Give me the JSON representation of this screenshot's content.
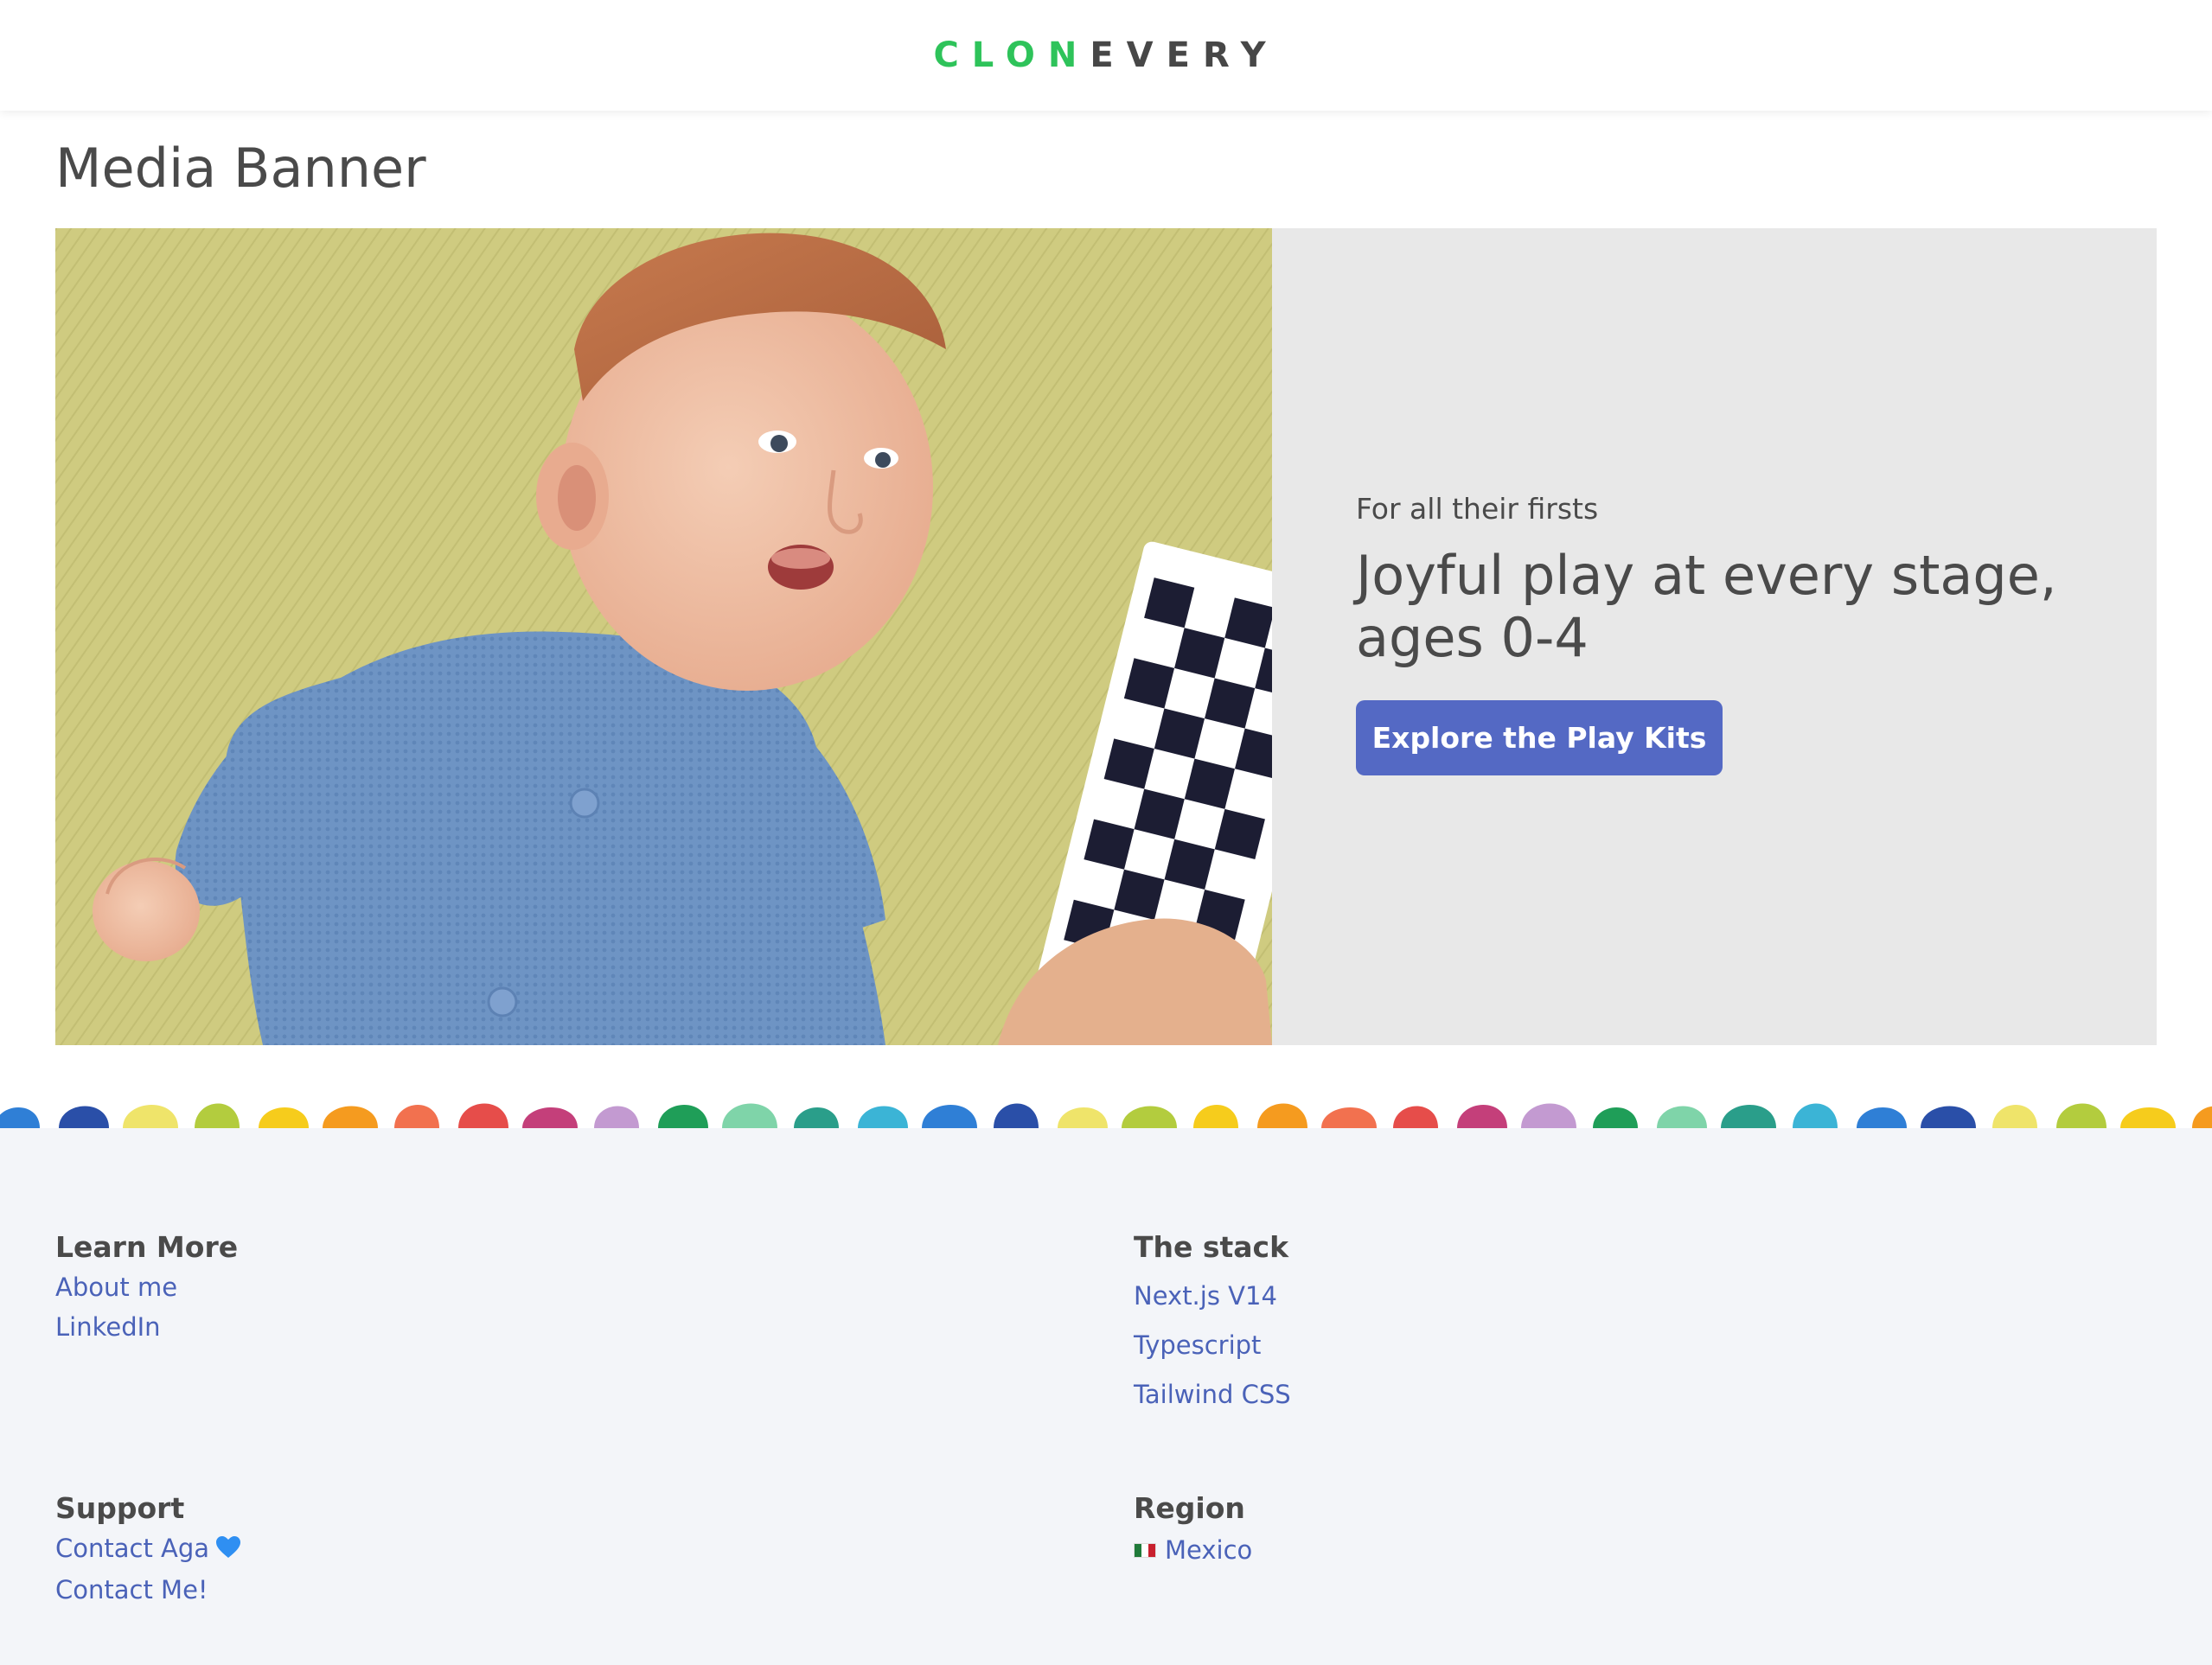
{
  "header": {
    "logo_part1": "CLON",
    "logo_part2": "EVERY",
    "logo_part1_color": "#2ec35a",
    "logo_part2_color": "#474747"
  },
  "page": {
    "title": "Media Banner"
  },
  "banner": {
    "eyebrow": "For all their firsts",
    "headline": "Joyful play at every stage, ages 0-4",
    "cta_label": "Explore the Play Kits",
    "cta_color": "#5469c4",
    "background_color": "#e8e8e8",
    "image_icon": "baby-photo-image"
  },
  "dots": {
    "colors": [
      "#2f7fd6",
      "#2a4fa8",
      "#efe46a",
      "#b3cc3e",
      "#f6cc1c",
      "#f59b1f",
      "#f2714f",
      "#e64d4a",
      "#c43f7a",
      "#c39ad1",
      "#1f9e58",
      "#7fd4a9",
      "#2a9e8a",
      "#3bb4d6"
    ]
  },
  "footer": {
    "learn_more": {
      "heading": "Learn More",
      "links": [
        "About me",
        "LinkedIn"
      ]
    },
    "stack": {
      "heading": "The stack",
      "links": [
        "Next.js V14",
        "Typescript",
        "Tailwind CSS"
      ]
    },
    "support": {
      "heading": "Support",
      "links": [
        "Contact Aga",
        "Contact Me!"
      ],
      "heart_icon": "blue-heart-icon"
    },
    "region": {
      "heading": "Region",
      "country": "Mexico",
      "flag_icon": "mexico-flag-icon"
    }
  }
}
